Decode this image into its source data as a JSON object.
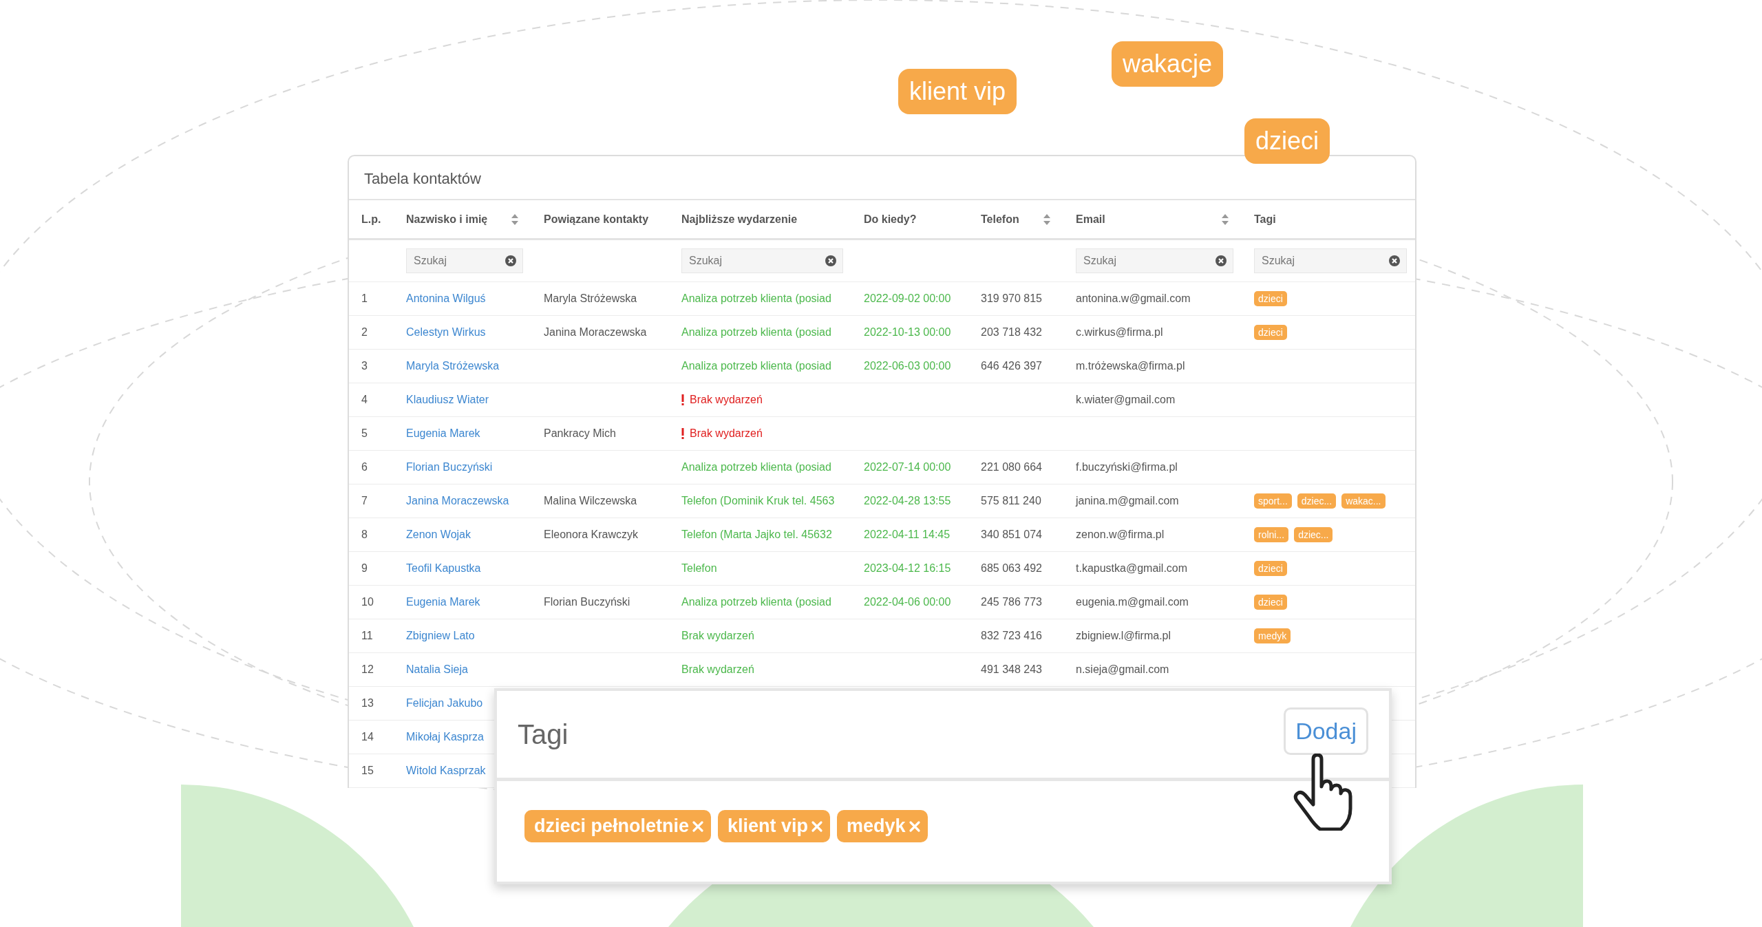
{
  "floating_tags": [
    {
      "label": "klient vip"
    },
    {
      "label": "wakacje"
    },
    {
      "label": "dzieci"
    }
  ],
  "table": {
    "title": "Tabela kontaktów",
    "columns": [
      {
        "label": "L.p."
      },
      {
        "label": "Nazwisko i imię",
        "sortable": true,
        "filter": "Szukaj"
      },
      {
        "label": "Powiązane kontakty"
      },
      {
        "label": "Najbliższe wydarzenie",
        "filter": "Szukaj"
      },
      {
        "label": "Do kiedy?"
      },
      {
        "label": "Telefon",
        "sortable": true
      },
      {
        "label": "Email",
        "sortable": true,
        "filter": "Szukaj"
      },
      {
        "label": "Tagi",
        "filter": "Szukaj"
      }
    ],
    "rows": [
      {
        "number": "1",
        "name": "Antonina Wilguś",
        "related": "Maryla Stróżewska",
        "event": {
          "text": "Analiza potrzeb klienta (posiad",
          "alert": false
        },
        "until": "2022-09-02 00:00",
        "phone": "319 970 815",
        "email": "antonina.w@gmail.com",
        "tags": [
          "dzieci"
        ]
      },
      {
        "number": "2",
        "name": "Celestyn Wirkus",
        "related": "Janina Moraczewska",
        "event": {
          "text": "Analiza potrzeb klienta (posiad",
          "alert": false
        },
        "until": "2022-10-13 00:00",
        "phone": "203 718 432",
        "email": "c.wirkus@firma.pl",
        "tags": [
          "dzieci"
        ]
      },
      {
        "number": "3",
        "name": "Maryla Stróżewska",
        "event": {
          "text": "Analiza potrzeb klienta (posiad",
          "alert": false
        },
        "until": "2022-06-03 00:00",
        "phone": "646 426 397",
        "email": "m.tróżewska@firma.pl"
      },
      {
        "number": "4",
        "name": "Klaudiusz Wiater",
        "event": {
          "text": "Brak wydarzeń",
          "alert": true
        },
        "email": "k.wiater@gmail.com"
      },
      {
        "number": "5",
        "name": "Eugenia Marek",
        "related": "Pankracy Mich",
        "event": {
          "text": "Brak wydarzeń",
          "alert": true
        }
      },
      {
        "number": "6",
        "name": "Florian Buczyński",
        "event": {
          "text": "Analiza potrzeb klienta (posiad",
          "alert": false
        },
        "until": "2022-07-14 00:00",
        "phone": "221 080 664",
        "email": "f.buczyński@firma.pl"
      },
      {
        "number": "7",
        "name": "Janina Moraczewska",
        "related": "Malina Wilczewska",
        "event": {
          "text": "Telefon (Dominik Kruk tel. 4563",
          "alert": false
        },
        "until": "2022-04-28 13:55",
        "phone": "575 811 240",
        "email": "janina.m@gmail.com",
        "tags": [
          "sport...",
          "dziec...",
          "wakac..."
        ]
      },
      {
        "number": "8",
        "name": "Zenon Wojak",
        "related": "Eleonora Krawczyk",
        "event": {
          "text": "Telefon (Marta Jajko tel. 45632",
          "alert": false
        },
        "until": "2022-04-11 14:45",
        "phone": "340 851 074",
        "email": "zenon.w@firma.pl",
        "tags": [
          "rolni...",
          "dziec..."
        ]
      },
      {
        "number": "9",
        "name": "Teofil Kapustka",
        "event": {
          "text": "Telefon",
          "alert": false
        },
        "until": "2023-04-12 16:15",
        "phone": "685 063 492",
        "email": "t.kapustka@gmail.com",
        "tags": [
          "dzieci"
        ]
      },
      {
        "number": "10",
        "name": "Eugenia Marek",
        "related": "Florian Buczyński",
        "event": {
          "text": "Analiza potrzeb klienta (posiad",
          "alert": false
        },
        "until": "2022-04-06 00:00",
        "phone": "245 786 773",
        "email": "eugenia.m@gmail.com",
        "tags": [
          "dzieci"
        ]
      },
      {
        "number": "11",
        "name": "Zbigniew Lato",
        "event": {
          "text": "Brak wydarzeń",
          "alert": false
        },
        "phone": "832 723 416",
        "email": "zbigniew.l@firma.pl",
        "tags": [
          "medyk"
        ]
      },
      {
        "number": "12",
        "name": "Natalia Sieja",
        "event": {
          "text": "Brak wydarzeń",
          "alert": false
        },
        "phone": "491 348 243",
        "email": "n.sieja@gmail.com"
      },
      {
        "number": "13",
        "name": "Felicjan Jakubo"
      },
      {
        "number": "14",
        "name": "Mikołaj Kasprza"
      },
      {
        "number": "15",
        "name": "Witold Kasprzak"
      }
    ]
  },
  "tags_panel": {
    "title": "Tagi",
    "button": "Dodaj",
    "tags": [
      {
        "label": "dzieci pełnoletnie"
      },
      {
        "label": "klient vip"
      },
      {
        "label": "medyk"
      }
    ]
  }
}
